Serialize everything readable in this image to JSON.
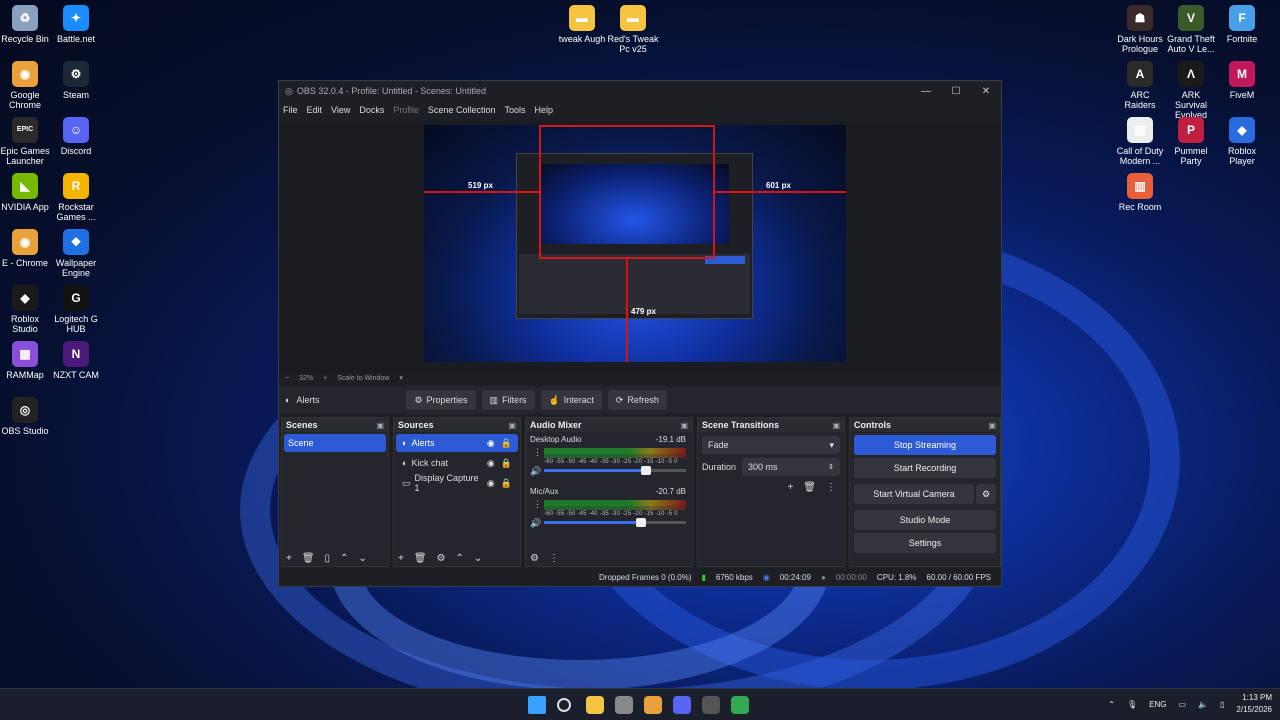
{
  "desktop": {
    "left_icons": [
      {
        "label": "Recycle Bin",
        "icon": "recycle-bin-icon",
        "color": "#8aa0c0",
        "glyph": "♻"
      },
      {
        "label": "Battle.net",
        "icon": "battlenet-icon",
        "color": "#1a8cff",
        "glyph": "✦"
      },
      {
        "label": "Google Chrome",
        "icon": "chrome-icon",
        "color": "#e9a23b",
        "glyph": "◉"
      },
      {
        "label": "Steam",
        "icon": "steam-icon",
        "color": "#1b2838",
        "glyph": "⚙"
      },
      {
        "label": "Epic Games Launcher",
        "icon": "epic-games-icon",
        "color": "#2a2a2a",
        "glyph": "EPIC"
      },
      {
        "label": "Discord",
        "icon": "discord-icon",
        "color": "#5865f2",
        "glyph": "☺"
      },
      {
        "label": "NVIDIA App",
        "icon": "nvidia-icon",
        "color": "#76b900",
        "glyph": "◣"
      },
      {
        "label": "Rockstar Games ...",
        "icon": "rockstar-icon",
        "color": "#f4b400",
        "glyph": "R"
      },
      {
        "label": "E - Chrome",
        "icon": "chrome-icon",
        "color": "#e9a23b",
        "glyph": "◉"
      },
      {
        "label": "Wallpaper Engine",
        "icon": "wallpaper-engine-icon",
        "color": "#1f6fe5",
        "glyph": "❖"
      },
      {
        "label": "Roblox Studio",
        "icon": "roblox-studio-icon",
        "color": "#1a1a1a",
        "glyph": "◆"
      },
      {
        "label": "Logitech G HUB",
        "icon": "logitech-icon",
        "color": "#111111",
        "glyph": "G"
      },
      {
        "label": "RAMMap",
        "icon": "rammap-icon",
        "color": "#8a4fd8",
        "glyph": "▦"
      },
      {
        "label": "NZXT CAM",
        "icon": "nzxt-icon",
        "color": "#4b1a7a",
        "glyph": "N"
      },
      {
        "label": "OBS Studio",
        "icon": "obs-icon",
        "color": "#222222",
        "glyph": "◎"
      }
    ],
    "center_icons": [
      {
        "label": "tweak Augh",
        "icon": "folder-icon",
        "color": "#f5c542",
        "glyph": "▬"
      },
      {
        "label": "Red's Tweak Pc v25",
        "icon": "folder-icon",
        "color": "#f5c542",
        "glyph": "▬"
      }
    ],
    "right_icons": [
      {
        "label": "Dark Hours Prologue",
        "icon": "dark-hours-icon",
        "color": "#3a2a2a",
        "glyph": "☗"
      },
      {
        "label": "Grand Theft Auto V Le...",
        "icon": "gta-icon",
        "color": "#3a5a2a",
        "glyph": "V"
      },
      {
        "label": "Fortnite",
        "icon": "fortnite-icon",
        "color": "#4aa0e8",
        "glyph": "F"
      },
      {
        "label": "ARC Raiders",
        "icon": "arc-raiders-icon",
        "color": "#2a2a2a",
        "glyph": "A"
      },
      {
        "label": "ARK Survival Evolved",
        "icon": "ark-icon",
        "color": "#1a1a1a",
        "glyph": "Λ"
      },
      {
        "label": "FiveM",
        "icon": "fivem-icon",
        "color": "#c0185a",
        "glyph": "M"
      },
      {
        "label": "Call of Duty Modern ...",
        "icon": "document-icon",
        "color": "#eeeeee",
        "glyph": "▤"
      },
      {
        "label": "Pummel Party",
        "icon": "pummel-party-icon",
        "color": "#c02040",
        "glyph": "P"
      },
      {
        "label": "Roblox Player",
        "icon": "roblox-icon",
        "color": "#2a6be0",
        "glyph": "◆"
      },
      {
        "label": "Rec Room",
        "icon": "rec-room-icon",
        "color": "#e8603a",
        "glyph": "▥"
      }
    ]
  },
  "obs": {
    "title": "OBS 32.0.4 - Profile: Untitled - Scenes: Untitled",
    "menu": [
      "File",
      "Edit",
      "View",
      "Docks",
      "Profile",
      "Scene Collection",
      "Tools",
      "Help"
    ],
    "preview": {
      "left_px": "519 px",
      "right_px": "601 px",
      "bottom_px": "479 px",
      "zoom": "32%",
      "scale_mode": "Scale to Window"
    },
    "source_toolbar": {
      "selected_source": "Alerts",
      "properties": "Properties",
      "filters": "Filters",
      "interact": "Interact",
      "refresh": "Refresh"
    },
    "scenes": {
      "title": "Scenes",
      "items": [
        "Scene"
      ]
    },
    "sources": {
      "title": "Sources",
      "items": [
        "Alerts",
        "Kick chat",
        "Display Capture 1"
      ]
    },
    "mixer": {
      "title": "Audio Mixer",
      "channels": [
        {
          "name": "Desktop Audio",
          "db": "-19.1 dB",
          "volume": 0.72
        },
        {
          "name": "Mic/Aux",
          "db": "-20.7 dB",
          "volume": 0.68
        }
      ],
      "ticks": "-60 -55 -50 -45 -40 -35 -30 -25 -20 -15 -10 -5 0"
    },
    "transitions": {
      "title": "Scene Transitions",
      "type": "Fade",
      "duration_label": "Duration",
      "duration": "300 ms"
    },
    "controls": {
      "title": "Controls",
      "stop_streaming": "Stop Streaming",
      "start_recording": "Start Recording",
      "start_virtual_camera": "Start Virtual Camera",
      "studio_mode": "Studio Mode",
      "settings": "Settings"
    },
    "status": {
      "dropped_frames": "Dropped Frames 0 (0.0%)",
      "bitrate": "6760 kbps",
      "stream_time": "00:24:09",
      "record_time": "00:00:00",
      "cpu": "CPU: 1.8%",
      "fps": "60.00 / 60.00 FPS"
    }
  },
  "taskbar": {
    "language": "ENG",
    "time": "1:13 PM",
    "date": "2/15/2026",
    "apps": [
      {
        "icon": "windows-start-icon",
        "color": "#3aa0ff"
      },
      {
        "icon": "search-icon",
        "color": "#dddddd"
      },
      {
        "icon": "file-explorer-icon",
        "color": "#f5c542"
      },
      {
        "icon": "terminal-icon",
        "color": "#888888"
      },
      {
        "icon": "chrome-icon",
        "color": "#e9a23b"
      },
      {
        "icon": "discord-icon",
        "color": "#5865f2"
      },
      {
        "icon": "obs-icon",
        "color": "#555555"
      },
      {
        "icon": "chrome-icon",
        "color": "#34a853"
      }
    ]
  }
}
